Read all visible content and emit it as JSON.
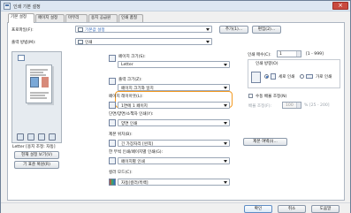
{
  "window": {
    "title": "인쇄 기본 설정"
  },
  "tabs": [
    {
      "label": "기본 설정"
    },
    {
      "label": "페이지 설정"
    },
    {
      "label": "마무리"
    },
    {
      "label": "용지 공급원"
    },
    {
      "label": "인쇄 품질"
    }
  ],
  "top": {
    "profile_label": "프로파일(F):",
    "profile_value": "기본값 설정",
    "add_button": "추가(1)...",
    "edit_button": "편집(2)...",
    "output_label": "출력 방법(M):",
    "output_value": "인쇄"
  },
  "preview": {
    "paper_info": "Letter [용지 조정: 자동]",
    "view_settings_button": "현재 설정 보기(V)",
    "language_button": "기 표준 복원(R)"
  },
  "settings": {
    "page_size_label": "페이지 크기(S):",
    "page_size_value": "Letter",
    "output_size_label": "출력 크기(Z):",
    "output_size_value": "페이지 크기와 일치",
    "layout_label": "페이지 레이아웃(L):",
    "layout_value": "1면에 1 페이지",
    "duplex_label": "단면/양면/소책자 인쇄(Y):",
    "duplex_value": "양면 인쇄",
    "binding_label": "제본 위치(B):",
    "binding_value": "긴 가장자리 [왼쪽]",
    "binding_button": "제본 여백(I)...",
    "manual_label": "한 부씩 인쇄/페이지별 인쇄(G):",
    "manual_value": "페이지별 인쇄",
    "color_label": "컬러 모드(C):",
    "color_value": "자동[컬러/흑백]"
  },
  "copies": {
    "label": "인쇄 매수(C):",
    "value": "1",
    "range": "[1 - 999]",
    "orientation_label": "인쇄 방향(O)",
    "portrait": "세로 인쇄",
    "landscape": "가로 인쇄",
    "manual_scale_label": "수동 배율 조정(N)",
    "scale_label": "배율 조정(F):",
    "scale_value": "100",
    "scale_range": "% [25 - 200]"
  },
  "footer": {
    "ok": "확인",
    "cancel": "취소",
    "help": "도움말"
  }
}
